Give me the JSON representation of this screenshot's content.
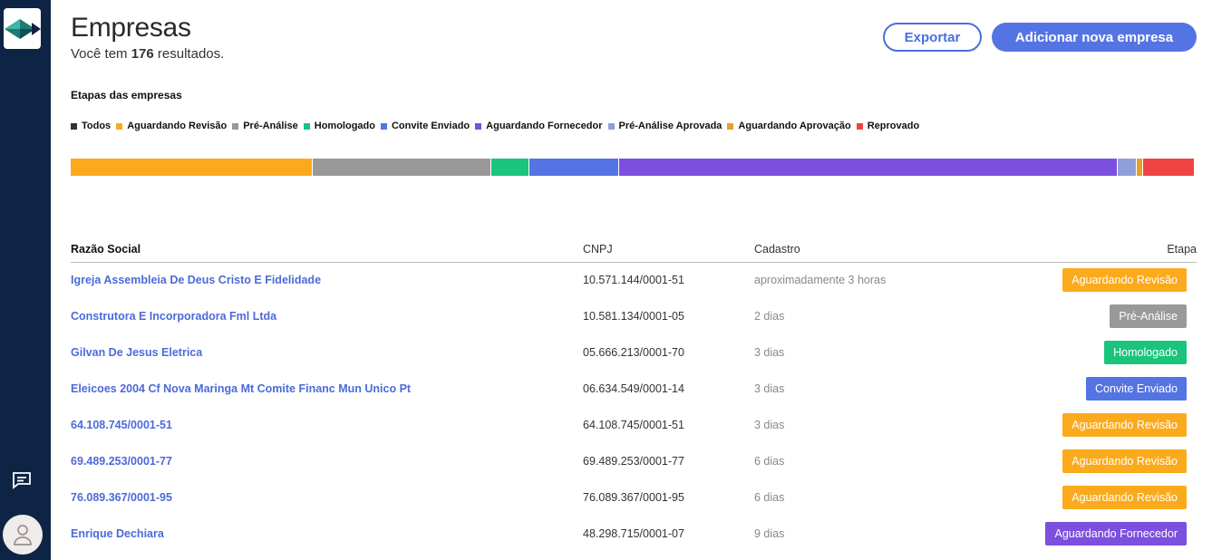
{
  "page": {
    "title": "Empresas",
    "results_prefix": "Você tem",
    "results_count": "176",
    "results_suffix": "resultados."
  },
  "actions": {
    "export_label": "Exportar",
    "add_label": "Adicionar nova empresa"
  },
  "stages": {
    "title": "Etapas das empresas",
    "legend": [
      {
        "label": "Todos",
        "color": "#333333"
      },
      {
        "label": "Aguardando Revisão",
        "color": "#fbaa1c"
      },
      {
        "label": "Pré-Análise",
        "color": "#999999"
      },
      {
        "label": "Homologado",
        "color": "#1bc47d"
      },
      {
        "label": "Convite Enviado",
        "color": "#5474e3"
      },
      {
        "label": "Aguardando Fornecedor",
        "color": "#7c4fdf"
      },
      {
        "label": "Pré-Análise Aprovada",
        "color": "#8f9fd8"
      },
      {
        "label": "Aguardando Aprovação",
        "color": "#e3a12b"
      },
      {
        "label": "Reprovado",
        "color": "#f04444"
      }
    ],
    "bar_shares": [
      {
        "label": "Aguardando Revisão",
        "share": 0.215,
        "color": "#fbaa1c"
      },
      {
        "label": "Pré-Análise",
        "share": 0.159,
        "color": "#999999"
      },
      {
        "label": "Homologado",
        "share": 0.034,
        "color": "#1bc47d"
      },
      {
        "label": "Convite Enviado",
        "share": 0.08,
        "color": "#5474e3"
      },
      {
        "label": "Aguardando Fornecedor",
        "share": 0.443,
        "color": "#7c4fdf"
      },
      {
        "label": "Pré-Análise Aprovada",
        "share": 0.017,
        "color": "#8f9fd8"
      },
      {
        "label": "Aguardando Aprovação",
        "share": 0.006,
        "color": "#e3a12b"
      },
      {
        "label": "Reprovado",
        "share": 0.046,
        "color": "#f04444"
      }
    ]
  },
  "table": {
    "headers": {
      "name": "Razão Social",
      "cnpj": "CNPJ",
      "created": "Cadastro",
      "stage": "Etapa"
    },
    "rows": [
      {
        "name": "Igreja Assembleia De Deus Cristo E Fidelidade",
        "cnpj": "10.571.144/0001-51",
        "created": "aproximadamente 3 horas",
        "stage": "Aguardando Revisão",
        "color": "#fbaa1c"
      },
      {
        "name": "Construtora E Incorporadora Fml Ltda",
        "cnpj": "10.581.134/0001-05",
        "created": "2 dias",
        "stage": "Pré-Análise",
        "color": "#999999"
      },
      {
        "name": "Gilvan De Jesus Eletrica",
        "cnpj": "05.666.213/0001-70",
        "created": "3 dias",
        "stage": "Homologado",
        "color": "#1bc47d"
      },
      {
        "name": "Eleicoes 2004 Cf Nova Maringa Mt Comite Financ Mun Unico Pt",
        "cnpj": "06.634.549/0001-14",
        "created": "3 dias",
        "stage": "Convite Enviado",
        "color": "#5474e3"
      },
      {
        "name": "64.108.745/0001-51",
        "cnpj": "64.108.745/0001-51",
        "created": "3 dias",
        "stage": "Aguardando Revisão",
        "color": "#fbaa1c"
      },
      {
        "name": "69.489.253/0001-77",
        "cnpj": "69.489.253/0001-77",
        "created": "6 dias",
        "stage": "Aguardando Revisão",
        "color": "#fbaa1c"
      },
      {
        "name": "76.089.367/0001-95",
        "cnpj": "76.089.367/0001-95",
        "created": "6 dias",
        "stage": "Aguardando Revisão",
        "color": "#fbaa1c"
      },
      {
        "name": "Enrique Dechiara",
        "cnpj": "48.298.715/0001-07",
        "created": "9 dias",
        "stage": "Aguardando Fornecedor",
        "color": "#7c4fdf"
      }
    ]
  },
  "icons": {
    "logo": "diamond-logo-icon",
    "chat": "chat-icon",
    "user": "user-icon"
  }
}
